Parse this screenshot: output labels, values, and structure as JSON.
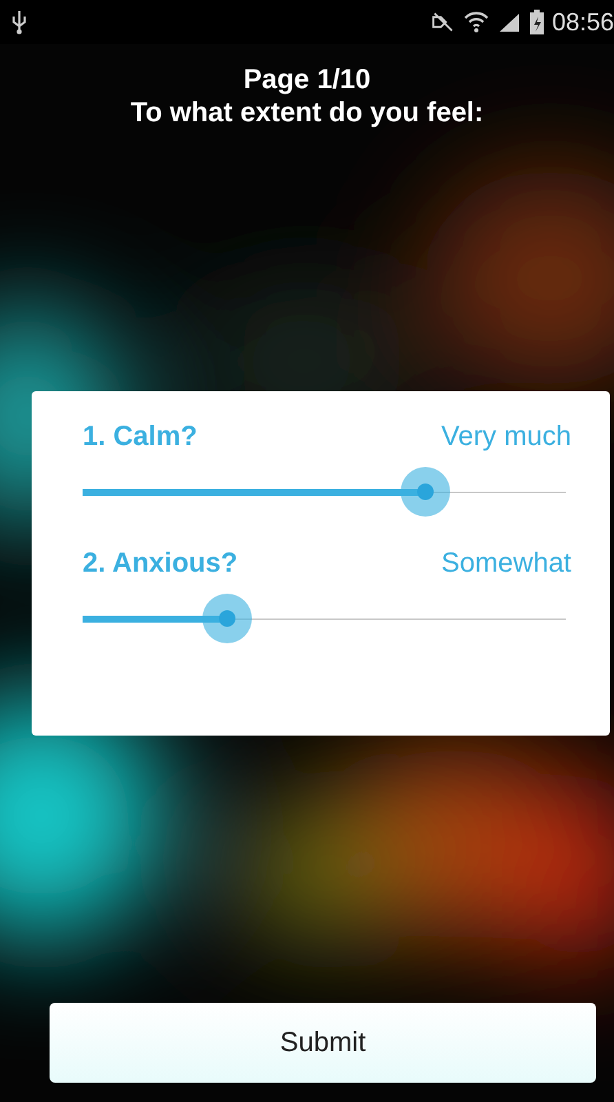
{
  "status_bar": {
    "time": "08:56"
  },
  "header": {
    "page": "Page 1/10",
    "prompt": "To what extent do you feel:"
  },
  "questions": [
    {
      "label": "1. Calm?",
      "reading": "Very much",
      "level": 0.71
    },
    {
      "label": "2. Anxious?",
      "reading": "Somewhat",
      "level": 0.3
    }
  ],
  "submit": {
    "label": "Submit"
  }
}
